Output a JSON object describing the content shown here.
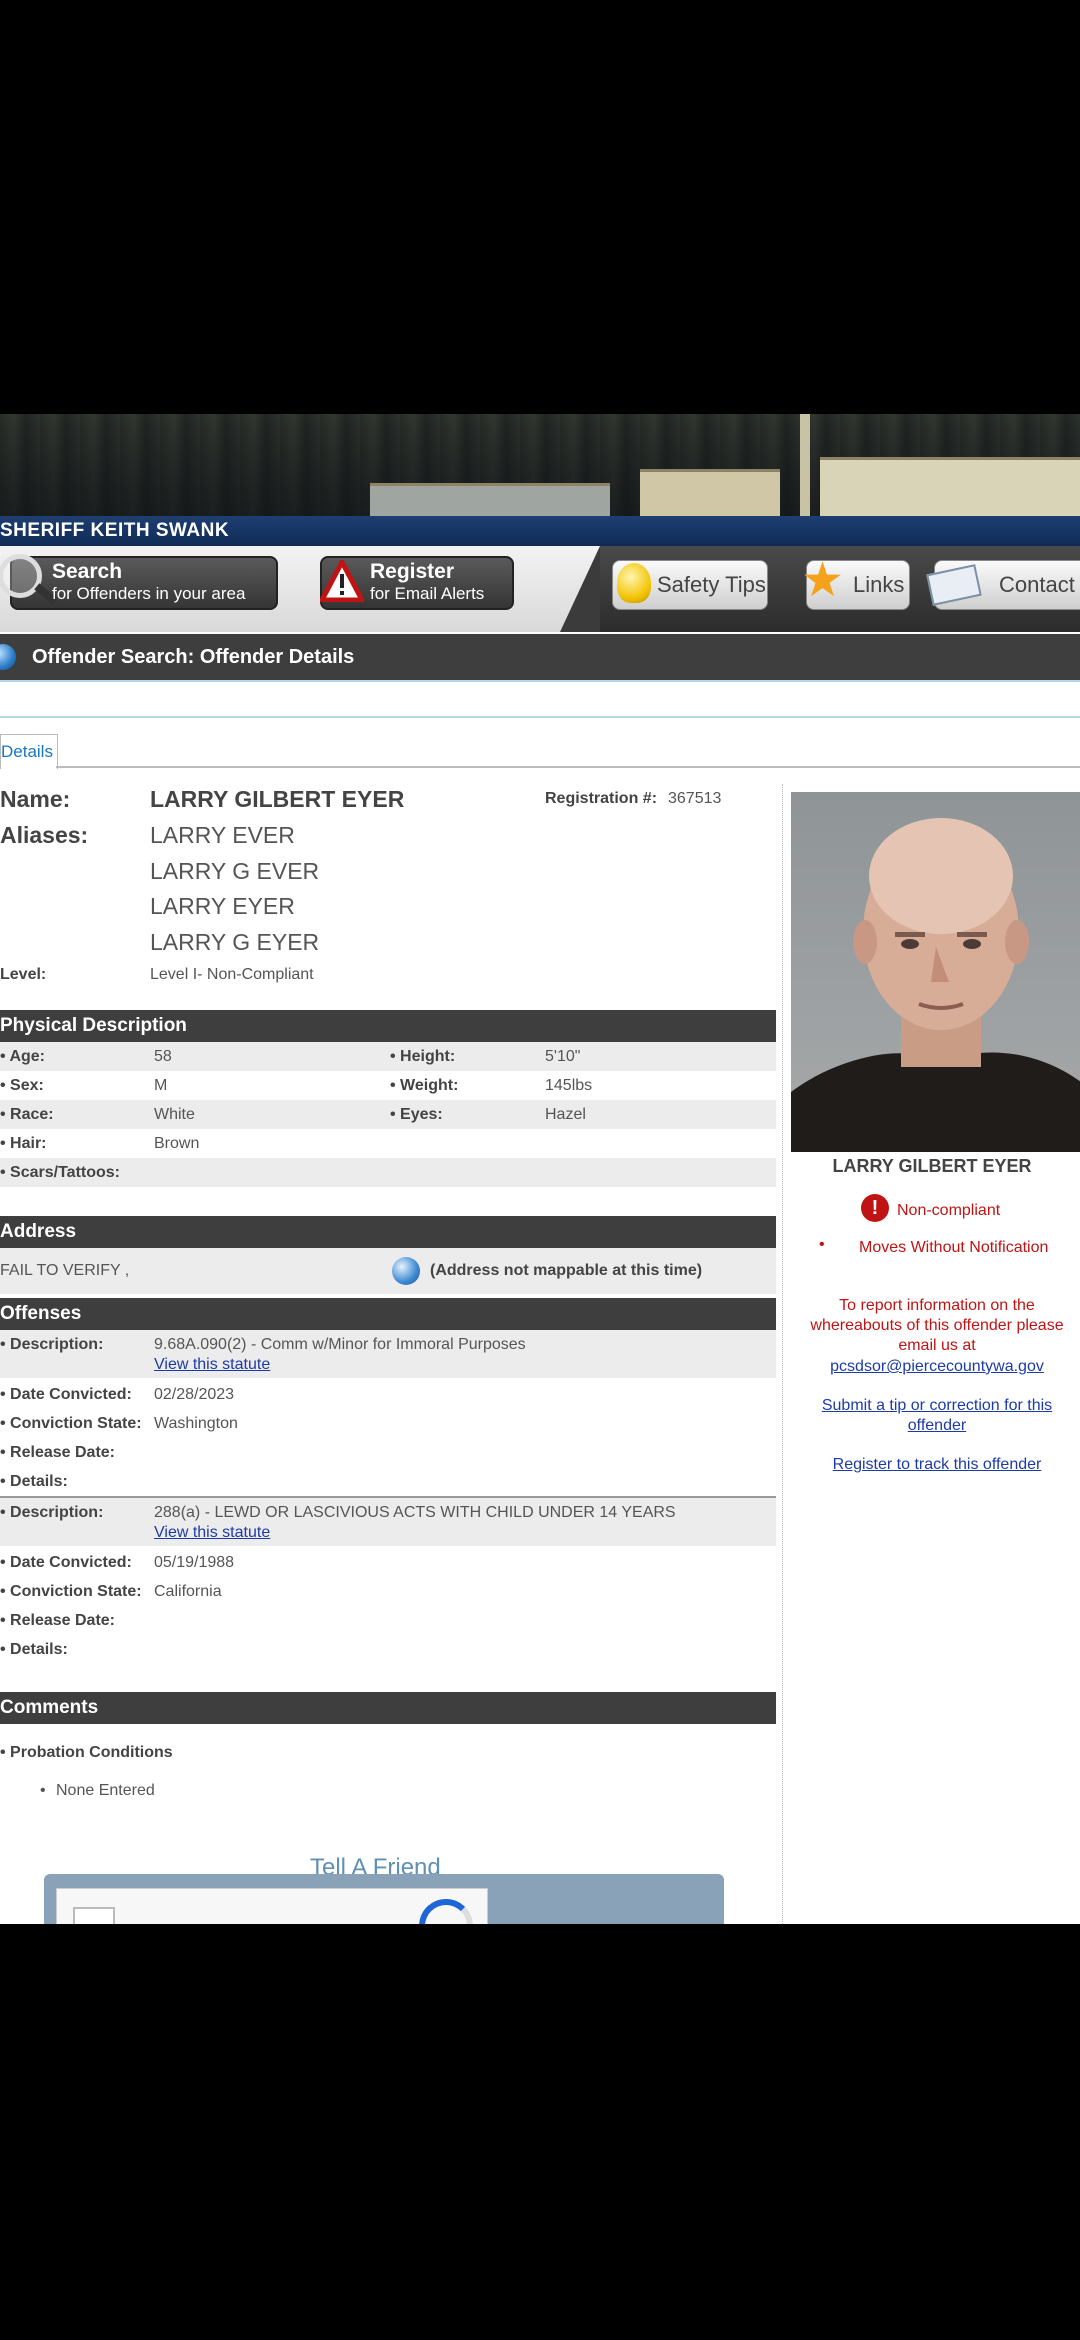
{
  "header": {
    "sheriff": "SHERIFF KEITH SWANK",
    "nav": {
      "search_title": "Search",
      "search_sub": "for Offenders in your area",
      "register_title": "Register",
      "register_sub": "for Email Alerts",
      "safety": "Safety Tips",
      "links": "Links",
      "contact": "Contact"
    }
  },
  "page_title": "Offender Search: Offender Details",
  "tab": "Details",
  "offender": {
    "name_label": "Name:",
    "name": "LARRY GILBERT EYER",
    "reg_label": "Registration #:",
    "reg_number": "367513",
    "aliases_label": "Aliases:",
    "aliases": [
      "LARRY EVER",
      "LARRY G EVER",
      "LARRY EYER",
      "LARRY G EYER"
    ],
    "level_label": "Level:",
    "level": "Level I- Non-Compliant"
  },
  "physical": {
    "heading": "Physical Description",
    "age_label": "• Age:",
    "age": "58",
    "height_label": "• Height:",
    "height": "5'10\"",
    "sex_label": "• Sex:",
    "sex": "M",
    "weight_label": "• Weight:",
    "weight": "145lbs",
    "race_label": "• Race:",
    "race": "White",
    "eyes_label": "• Eyes:",
    "eyes": "Hazel",
    "hair_label": "• Hair:",
    "hair": "Brown",
    "scars_label": "• Scars/Tattoos:"
  },
  "address": {
    "heading": "Address",
    "value": "FAIL TO VERIFY ,",
    "map_note": "(Address not mappable at this time)"
  },
  "offenses": {
    "heading": "Offenses",
    "desc_label": "• Description:",
    "statute_link": "View this statute",
    "date_label": "• Date Convicted:",
    "state_label": "• Conviction State:",
    "release_label": "• Release Date:",
    "details_label": "• Details:",
    "items": [
      {
        "description": "9.68A.090(2) - Comm w/Minor for Immoral Purposes",
        "date": "02/28/2023",
        "state": "Washington"
      },
      {
        "description": "288(a) - LEWD OR LASCIVIOUS ACTS WITH CHILD UNDER 14 YEARS",
        "date": "05/19/1988",
        "state": "California"
      }
    ]
  },
  "comments": {
    "heading": "Comments",
    "probation_label": "• Probation Conditions",
    "probation_value": "None Entered"
  },
  "tell_friend": "Tell A Friend",
  "sidebar": {
    "photo_name": "LARRY GILBERT EYER",
    "status": "Non-compliant",
    "status_detail": "Moves Without Notification",
    "report_text": "To report information on the whereabouts of this offender please email us at",
    "email": "pcsdsor@piercecountywa.gov",
    "tip_link": "Submit a tip or correction for this offender",
    "track_link": "Register to track this offender"
  },
  "colors": {
    "accent_blue": "#1d3ba8",
    "alert_red": "#c01414",
    "section_bg": "#3e3e3e"
  }
}
